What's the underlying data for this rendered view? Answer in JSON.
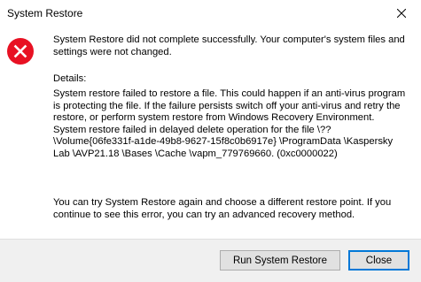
{
  "window": {
    "title": "System Restore",
    "close_icon": "close-icon"
  },
  "message": {
    "icon": "error-icon",
    "icon_color": "#e81123",
    "main": "System Restore did not complete successfully. Your computer's system files and settings were not changed.",
    "details_label": "Details:",
    "details": "System restore failed to restore a file. This could happen if an anti-virus program is protecting the file. If the failure persists switch off your anti-virus and retry the restore, or perform system restore from Windows Recovery Environment. System restore failed in delayed delete operation for the file \\?? \\Volume{06fe331f-a1de-49b8-9627-15f8c0b6917e} \\ProgramData \\Kaspersky Lab \\AVP21.18 \\Bases \\Cache \\vapm_779769660. (0xc0000022)",
    "hint": "You can try System Restore again and choose a different restore point. If you continue to see this error, you can try an advanced recovery method."
  },
  "buttons": {
    "run_label": "Run System Restore",
    "close_label": "Close",
    "focus_color": "#0078d7"
  }
}
